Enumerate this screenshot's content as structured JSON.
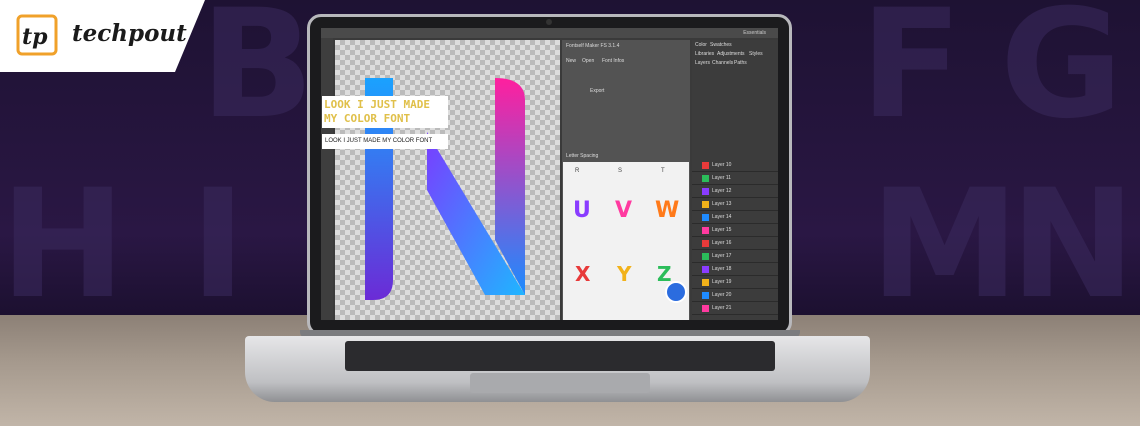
{
  "brand": {
    "logo_text": "techpout",
    "logo_mark": "tp"
  },
  "app": {
    "plugin_title": "Fontself Maker FS 3.1.4",
    "plugin_tabs": [
      "New",
      "Open",
      "Font Infos"
    ],
    "sample_text_line1": "LOOK I JUST MADE",
    "sample_text_line2": "MY COLOR FONT",
    "input_value": "LOOK I JUST MADE MY COLOR FONT",
    "letter_spacing_label": "Letter Spacing",
    "export_label": "Export",
    "glyph_row1": [
      "R",
      "S",
      "T"
    ],
    "glyph_row2": [
      "U",
      "V",
      "W"
    ],
    "glyph_row3": [
      "X",
      "Y",
      "Z"
    ],
    "right_tabs": [
      "Color",
      "Swatches"
    ],
    "right_subtabs": [
      "Libraries",
      "Adjustments",
      "Styles"
    ],
    "layers_tabs": [
      "Layers",
      "Channels",
      "Paths"
    ],
    "layer_items": [
      "Layer 10",
      "Layer 11",
      "Layer 12",
      "Layer 13",
      "Layer 14",
      "Layer 15",
      "Layer 16",
      "Layer 17",
      "Layer 18",
      "Layer 19",
      "Layer 20",
      "Layer 21"
    ],
    "top_menu": "Essentials"
  },
  "colors": {
    "accent_blue": "#1f8bff",
    "accent_pink": "#ff2aa6",
    "chat_button": "#2b6cdf"
  }
}
